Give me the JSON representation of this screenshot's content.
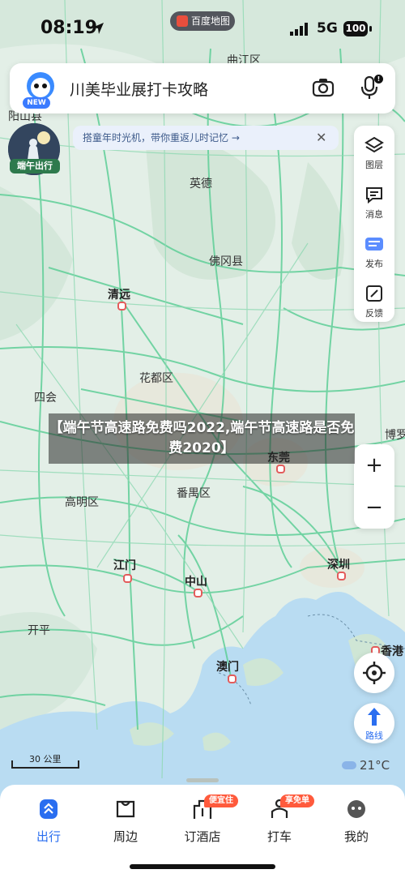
{
  "status_bar": {
    "time": "08:19",
    "app_name": "百度地图",
    "network": "5G",
    "battery": "100"
  },
  "search": {
    "placeholder": "川美毕业展打卡攻略",
    "new_badge": "NEW",
    "mic_badge": "!"
  },
  "promo": {
    "label": "端午出行"
  },
  "tip": {
    "text": "搭童年时光机，带你重返儿时记忆 →",
    "close": "✕"
  },
  "toolbar": {
    "items": [
      {
        "label": "图层",
        "icon": "layers-icon"
      },
      {
        "label": "消息",
        "icon": "message-icon"
      },
      {
        "label": "发布",
        "icon": "publish-icon"
      },
      {
        "label": "反馈",
        "icon": "feedback-icon"
      }
    ]
  },
  "zoom": {
    "in": "+",
    "out": "−"
  },
  "route_label": "路线",
  "scale": "30 公里",
  "weather": "21°C",
  "banner": "【端午节高速路免费吗2022,端午节高速路是否免费2020】",
  "map_labels": {
    "qujiang": "曲江区",
    "yangshan": "阳山县",
    "yingde": "英德",
    "fogang": "佛冈县",
    "qingyuan": "清远",
    "huadu": "花都区",
    "sihui": "四会",
    "dongguan": "东莞",
    "boluo": "博罗",
    "gaoming": "高明区",
    "panyu": "番禺区",
    "jiangmen": "江门",
    "zhongshan": "中山",
    "shenzhen": "深圳",
    "kaiping": "开平",
    "macau": "澳门",
    "hongkong": "香港"
  },
  "bottom_tabs": [
    {
      "label": "出行",
      "icon": "travel-icon",
      "active": true
    },
    {
      "label": "周边",
      "icon": "nearby-icon"
    },
    {
      "label": "订酒店",
      "icon": "hotel-icon",
      "tag": "便宜住"
    },
    {
      "label": "打车",
      "icon": "taxi-icon",
      "tag": "享免单"
    },
    {
      "label": "我的",
      "icon": "profile-icon"
    }
  ]
}
